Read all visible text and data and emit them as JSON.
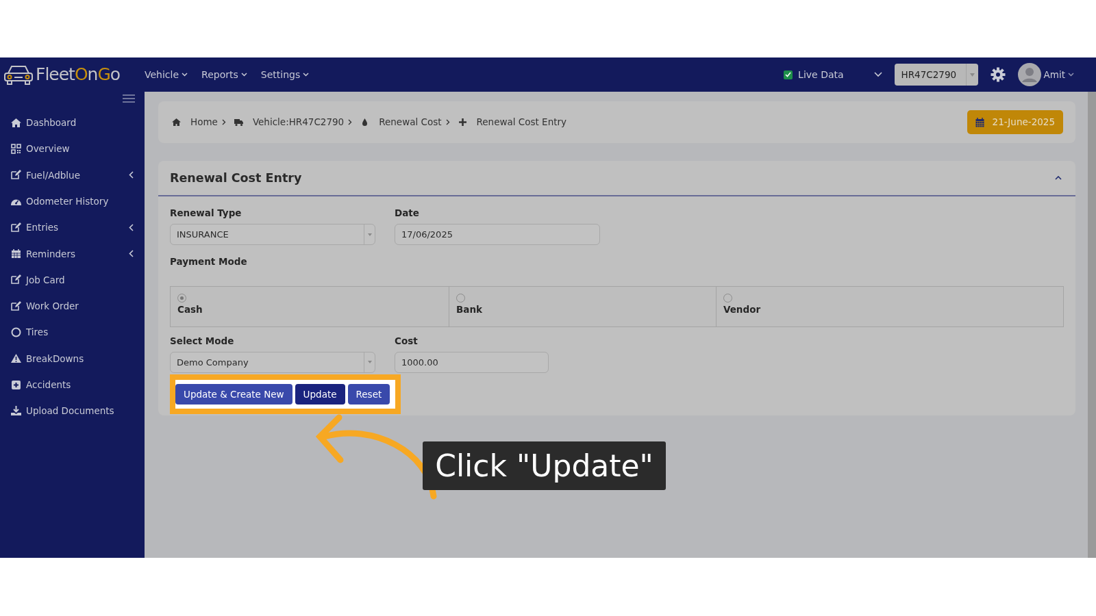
{
  "navbar": {
    "logo": [
      {
        "text": "Fleet",
        "accent": false
      },
      {
        "text": "O",
        "accent": true
      },
      {
        "text": "n",
        "accent": false
      },
      {
        "text": "G",
        "accent": true
      },
      {
        "text": "o",
        "accent": false
      }
    ],
    "menus": [
      {
        "label": "Vehicle"
      },
      {
        "label": "Reports"
      },
      {
        "label": "Settings"
      }
    ],
    "live_data": {
      "label": "Live Data",
      "checked": true
    },
    "vehicle_select": {
      "value": "HR47C2790"
    },
    "user": {
      "name": "Amit"
    }
  },
  "sidebar": {
    "items": [
      {
        "label": "Dashboard",
        "has_submenu": false
      },
      {
        "label": "Overview",
        "has_submenu": false
      },
      {
        "label": "Fuel/Adblue",
        "has_submenu": true
      },
      {
        "label": "Odometer History",
        "has_submenu": false
      },
      {
        "label": "Entries",
        "has_submenu": true
      },
      {
        "label": "Reminders",
        "has_submenu": true
      },
      {
        "label": "Job Card",
        "has_submenu": false
      },
      {
        "label": "Work Order",
        "has_submenu": false
      },
      {
        "label": "Tires",
        "has_submenu": false
      },
      {
        "label": "BreakDowns",
        "has_submenu": false
      },
      {
        "label": "Accidents",
        "has_submenu": false
      },
      {
        "label": "Upload Documents",
        "has_submenu": false
      }
    ]
  },
  "breadcrumb": {
    "items": [
      {
        "label": "Home"
      },
      {
        "label": "Vehicle:HR47C2790"
      },
      {
        "label": "Renewal Cost"
      },
      {
        "label": "Renewal Cost Entry"
      }
    ],
    "date": "21-June-2025"
  },
  "form": {
    "title": "Renewal Cost Entry",
    "renewal_type": {
      "label": "Renewal Type",
      "value": "INSURANCE"
    },
    "date": {
      "label": "Date",
      "value": "17/06/2025"
    },
    "payment_mode": {
      "label": "Payment Mode",
      "options": [
        {
          "label": "Cash",
          "selected": true
        },
        {
          "label": "Bank",
          "selected": false
        },
        {
          "label": "Vendor",
          "selected": false
        }
      ]
    },
    "select_mode": {
      "label": "Select Mode",
      "value": "Demo Company"
    },
    "cost": {
      "label": "Cost",
      "value": "1000.00"
    },
    "buttons": [
      {
        "label": "Update & Create New",
        "kind": "secondary"
      },
      {
        "label": "Update",
        "kind": "primary"
      },
      {
        "label": "Reset",
        "kind": "secondary"
      }
    ]
  },
  "callout": {
    "text": "Click \"Update\""
  }
}
